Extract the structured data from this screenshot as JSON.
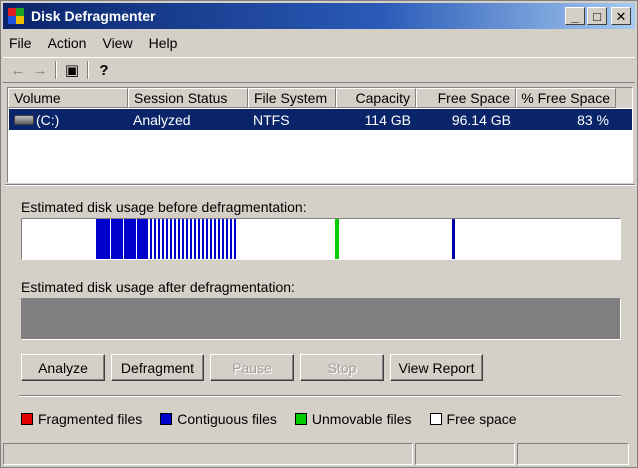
{
  "window": {
    "title": "Disk Defragmenter",
    "minimize_glyph": "_",
    "maximize_glyph": "□",
    "close_glyph": "✕"
  },
  "menu": {
    "file": "File",
    "action": "Action",
    "view": "View",
    "help": "Help"
  },
  "toolbar": {
    "back_glyph": "←",
    "forward_glyph": "→",
    "show_hide_glyph": "▣",
    "help_glyph": "?"
  },
  "volume_list": {
    "columns": [
      "Volume",
      "Session Status",
      "File System",
      "Capacity",
      "Free Space",
      "% Free Space"
    ],
    "rows": [
      {
        "volume": "(C:)",
        "session_status": "Analyzed",
        "file_system": "NTFS",
        "capacity": "114 GB",
        "free_space": "96.14 GB",
        "percent_free": "83 %"
      }
    ]
  },
  "before": {
    "label": "Estimated disk usage before defragmentation:"
  },
  "after": {
    "label": "Estimated disk usage after defragmentation:"
  },
  "buttons": {
    "analyze": "Analyze",
    "defragment": "Defragment",
    "pause": "Pause",
    "stop": "Stop",
    "view_report": "View Report"
  },
  "legend": {
    "fragmented": "Fragmented files",
    "contiguous": "Contiguous files",
    "unmovable": "Unmovable files",
    "free": "Free space"
  },
  "colors": {
    "fragmented": "#e00000",
    "contiguous": "#0000cc",
    "unmovable": "#00cc00",
    "free": "#ffffff",
    "selection": "#0a246a",
    "after_bar": "#808080"
  }
}
